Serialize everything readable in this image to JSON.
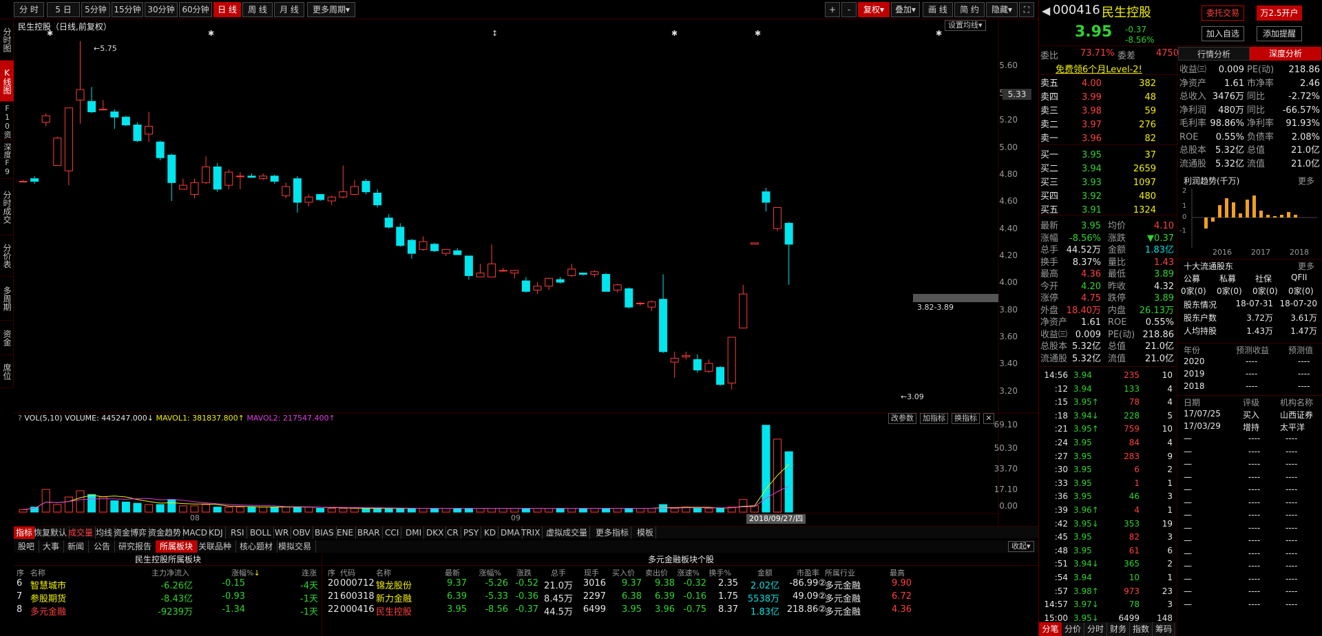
{
  "toolbar": {
    "periods": [
      "分 时",
      "5 日",
      "5分钟",
      "15分钟",
      "30分钟",
      "60分钟",
      "日 线",
      "周 线",
      "月 线",
      "更多周期"
    ],
    "active_period": 6,
    "right_tools": [
      "+",
      "-",
      "复权",
      "叠加",
      "画 线",
      "简 约",
      "隐藏",
      "⛶"
    ]
  },
  "left_tabs": [
    "分时图",
    "K线图",
    "F10资料",
    "深度F9",
    "分时成交",
    "分价表",
    "多周期",
    "资金",
    "席位"
  ],
  "left_active": 1,
  "chart": {
    "title": "民生控股（日线,前复权）",
    "ma_setting": "设置均线",
    "price_labels": [
      "5.60",
      "5.40",
      "5.20",
      "5.00",
      "4.80",
      "4.60",
      "4.40",
      "4.20",
      "4.00",
      "3.80",
      "3.60",
      "3.40",
      "3.20"
    ],
    "current_price_tag": "5.33",
    "high_label": "5.75",
    "low_label": "3.09",
    "range_label": "3.82-3.89",
    "vol_header": {
      "name": "VOL(5,10)",
      "volume": "VOLUME: 445247.000",
      "mavol1": "MAVOL1: 381837.800",
      "mavol2": "MAVOL2: 217547.400"
    },
    "vol_buttons": [
      "改参数",
      "加指标",
      "换指标",
      "✕"
    ],
    "vol_labels": [
      "69.10",
      "50.30",
      "33.70",
      "17.10",
      "0.00"
    ],
    "x_labels": [
      "08",
      "09"
    ],
    "date_label": "2018/09/27/四"
  },
  "chart_data": {
    "type": "candlestick",
    "candles": [
      [
        4.68,
        4.68,
        4.69,
        4.68
      ],
      [
        4.7,
        4.68,
        4.72,
        4.66
      ],
      [
        5.13,
        5.18,
        5.2,
        5.1
      ],
      [
        4.8,
        5.01,
        5.02,
        4.8
      ],
      [
        4.76,
        5.24,
        5.24,
        4.65
      ],
      [
        5.3,
        5.38,
        5.75,
        5.12
      ],
      [
        5.29,
        5.21,
        5.4,
        5.2
      ],
      [
        5.23,
        5.23,
        5.3,
        5.22
      ],
      [
        5.21,
        5.17,
        5.23,
        5.08
      ],
      [
        5.17,
        5.11,
        5.18,
        5.1
      ],
      [
        5.11,
        4.99,
        5.13,
        4.98
      ],
      [
        5.04,
        5.1,
        5.21,
        4.98
      ],
      [
        4.98,
        4.86,
        4.99,
        4.84
      ],
      [
        4.88,
        4.67,
        4.89,
        4.53
      ],
      [
        4.62,
        4.65,
        4.7,
        4.62
      ],
      [
        4.58,
        4.67,
        4.7,
        4.55
      ],
      [
        4.67,
        4.79,
        4.87,
        4.66
      ],
      [
        4.79,
        4.62,
        4.82,
        4.6
      ],
      [
        4.65,
        4.75,
        4.77,
        4.62
      ],
      [
        4.72,
        4.72,
        4.75,
        4.62
      ],
      [
        4.72,
        4.71,
        4.74,
        4.71
      ],
      [
        4.7,
        4.72,
        4.74,
        4.69
      ],
      [
        4.72,
        4.68,
        4.73,
        4.66
      ],
      [
        4.57,
        4.64,
        4.67,
        4.55
      ],
      [
        4.7,
        4.52,
        4.72,
        4.44
      ],
      [
        4.52,
        4.56,
        4.58,
        4.49
      ],
      [
        4.58,
        4.54,
        4.58,
        4.53
      ],
      [
        4.53,
        4.56,
        4.57,
        4.5
      ],
      [
        4.56,
        4.6,
        4.8,
        4.55
      ],
      [
        4.58,
        4.64,
        4.69,
        4.58
      ],
      [
        4.68,
        4.6,
        4.7,
        4.58
      ],
      [
        4.59,
        4.5,
        4.62,
        4.48
      ],
      [
        4.4,
        4.33,
        4.43,
        4.32
      ],
      [
        4.33,
        4.19,
        4.36,
        4.18
      ],
      [
        4.23,
        4.13,
        4.24,
        4.09
      ],
      [
        4.16,
        4.22,
        4.26,
        4.15
      ],
      [
        4.2,
        4.15,
        4.21,
        4.14
      ],
      [
        4.13,
        4.16,
        4.16,
        4.11
      ],
      [
        4.15,
        4.12,
        4.17,
        4.12
      ],
      [
        4.11,
        3.96,
        4.11,
        3.93
      ],
      [
        3.95,
        3.98,
        4.05,
        3.95
      ],
      [
        3.95,
        4.05,
        4.2,
        3.95
      ],
      [
        4.0,
        4.0,
        4.02,
        3.99
      ],
      [
        3.98,
        4.0,
        4.0,
        3.94
      ],
      [
        3.92,
        3.84,
        3.95,
        3.83
      ],
      [
        3.85,
        3.88,
        3.91,
        3.82
      ],
      [
        3.88,
        3.94,
        3.94,
        3.85
      ],
      [
        3.93,
        3.91,
        3.95,
        3.9
      ],
      [
        3.96,
        4.01,
        4.05,
        3.95
      ],
      [
        3.98,
        3.97,
        3.98,
        3.96
      ],
      [
        3.97,
        3.99,
        4.0,
        3.95
      ],
      [
        3.97,
        3.84,
        3.98,
        3.84
      ],
      [
        3.85,
        3.89,
        3.9,
        3.83
      ],
      [
        3.86,
        3.72,
        3.87,
        3.71
      ],
      [
        3.75,
        3.75,
        3.76,
        3.73
      ],
      [
        3.72,
        3.76,
        3.77,
        3.69
      ],
      [
        3.78,
        3.38,
        3.97,
        3.37
      ],
      [
        3.3,
        3.33,
        3.38,
        3.18
      ],
      [
        3.34,
        3.35,
        3.38,
        3.32
      ],
      [
        3.32,
        3.24,
        3.36,
        3.22
      ],
      [
        3.23,
        3.29,
        3.32,
        3.22
      ],
      [
        3.26,
        3.13,
        3.27,
        3.12
      ],
      [
        3.14,
        3.49,
        3.49,
        3.09
      ],
      [
        3.56,
        3.82,
        3.89,
        3.56
      ],
      [
        4.2,
        4.21,
        4.21,
        4.2
      ],
      [
        4.6,
        4.52,
        4.63,
        4.45
      ],
      [
        4.32,
        4.48,
        4.48,
        4.3
      ],
      [
        4.36,
        4.2,
        4.37,
        3.89
      ]
    ],
    "volume": [
      2,
      4,
      18,
      6,
      12,
      17,
      14,
      12,
      9,
      8,
      7,
      6,
      6,
      10,
      5,
      5,
      6,
      4,
      4,
      4,
      4,
      4,
      4,
      4,
      4,
      4,
      3,
      3,
      3,
      3,
      3,
      3,
      3,
      3,
      3,
      3,
      3,
      3,
      3,
      3,
      3,
      3,
      3,
      3,
      3,
      3,
      3,
      3,
      3,
      3,
      3,
      3,
      3,
      3,
      3,
      3,
      6,
      3,
      4,
      3,
      3,
      3,
      4,
      10,
      5,
      69,
      58,
      48
    ],
    "ylim": [
      3.08,
      5.78
    ]
  },
  "stock": {
    "code": "000416",
    "name": "民生控股",
    "price": "3.95",
    "change": "-0.37",
    "pct": "-8.56%",
    "buttons": {
      "order": "委托交易",
      "open": "万2.5开户",
      "watch": "加入自选",
      "alert": "添加提醒"
    }
  },
  "weibi": {
    "label1": "委比",
    "v1": "73.71%",
    "label2": "委差",
    "v2": "4750",
    "promo": "免费领6个月Level-2!"
  },
  "orderbook": [
    {
      "l": "卖五",
      "p": "4.00",
      "v": "382",
      "pc": "r"
    },
    {
      "l": "卖四",
      "p": "3.99",
      "v": "48",
      "pc": "r"
    },
    {
      "l": "卖三",
      "p": "3.98",
      "v": "59",
      "pc": "r"
    },
    {
      "l": "卖二",
      "p": "3.97",
      "v": "276",
      "pc": "r"
    },
    {
      "l": "卖一",
      "p": "3.96",
      "v": "82",
      "pc": "r"
    },
    {
      "l": "买一",
      "p": "3.95",
      "v": "37",
      "pc": "g"
    },
    {
      "l": "买二",
      "p": "3.94",
      "v": "2659",
      "pc": "g"
    },
    {
      "l": "买三",
      "p": "3.93",
      "v": "1097",
      "pc": "g"
    },
    {
      "l": "买四",
      "p": "3.92",
      "v": "480",
      "pc": "g"
    },
    {
      "l": "买五",
      "p": "3.91",
      "v": "1324",
      "pc": "g"
    }
  ],
  "stats": [
    [
      {
        "k": "最新",
        "v": "3.95",
        "c": "g"
      },
      {
        "k": "均价",
        "v": "4.10",
        "c": "r"
      }
    ],
    [
      {
        "k": "涨幅",
        "v": "-8.56%",
        "c": "g"
      },
      {
        "k": "涨跌",
        "v": "▼0.37",
        "c": "g"
      }
    ],
    [
      {
        "k": "总手",
        "v": "44.52万",
        "c": "w"
      },
      {
        "k": "金额",
        "v": "1.83亿",
        "c": "c"
      }
    ],
    [
      {
        "k": "换手",
        "v": "8.37%",
        "c": "w"
      },
      {
        "k": "量比",
        "v": "1.43",
        "c": "r"
      }
    ],
    [
      {
        "k": "最高",
        "v": "4.36",
        "c": "r"
      },
      {
        "k": "最低",
        "v": "3.89",
        "c": "g"
      }
    ],
    [
      {
        "k": "今开",
        "v": "4.20",
        "c": "g"
      },
      {
        "k": "昨收",
        "v": "4.32",
        "c": "w"
      }
    ],
    [
      {
        "k": "涨停",
        "v": "4.75",
        "c": "r"
      },
      {
        "k": "跌停",
        "v": "3.89",
        "c": "g"
      }
    ],
    [
      {
        "k": "外盘",
        "v": "18.40万",
        "c": "r"
      },
      {
        "k": "内盘",
        "v": "26.13万",
        "c": "g"
      }
    ],
    [
      {
        "k": "净资产",
        "v": "1.61",
        "c": "w"
      },
      {
        "k": "ROE",
        "v": "0.55%",
        "c": "w"
      }
    ],
    [
      {
        "k": "收益㈢",
        "v": "0.009",
        "c": "w"
      },
      {
        "k": "PE(动)",
        "v": "218.86",
        "c": "w"
      }
    ],
    [
      {
        "k": "总股本",
        "v": "5.32亿",
        "c": "w"
      },
      {
        "k": "总值",
        "v": "21.0亿",
        "c": "w"
      }
    ],
    [
      {
        "k": "流通股",
        "v": "5.32亿",
        "c": "w"
      },
      {
        "k": "流值",
        "v": "21.0亿",
        "c": "w"
      }
    ]
  ],
  "ticks": [
    {
      "t": "14:56",
      "p": "3.94",
      "v": "235",
      "n": "10",
      "pc": "g",
      "vc": "r"
    },
    {
      "t": ":12",
      "p": "3.94",
      "v": "133",
      "n": "4",
      "pc": "g",
      "vc": "g"
    },
    {
      "t": ":15",
      "p": "3.95↑",
      "v": "78",
      "n": "4",
      "pc": "g",
      "vc": "r"
    },
    {
      "t": ":18",
      "p": "3.94↓",
      "v": "228",
      "n": "5",
      "pc": "g",
      "vc": "g"
    },
    {
      "t": ":21",
      "p": "3.95↑",
      "v": "759",
      "n": "10",
      "pc": "g",
      "vc": "r"
    },
    {
      "t": ":24",
      "p": "3.95",
      "v": "84",
      "n": "4",
      "pc": "g",
      "vc": "r"
    },
    {
      "t": ":27",
      "p": "3.95",
      "v": "283",
      "n": "9",
      "pc": "g",
      "vc": "r"
    },
    {
      "t": ":30",
      "p": "3.95",
      "v": "6",
      "n": "2",
      "pc": "g",
      "vc": "r"
    },
    {
      "t": ":33",
      "p": "3.95",
      "v": "1",
      "n": "1",
      "pc": "g",
      "vc": "r"
    },
    {
      "t": ":36",
      "p": "3.95",
      "v": "46",
      "n": "3",
      "pc": "g",
      "vc": "g"
    },
    {
      "t": ":39",
      "p": "3.96↑",
      "v": "4",
      "n": "1",
      "pc": "g",
      "vc": "r"
    },
    {
      "t": ":42",
      "p": "3.95↓",
      "v": "353",
      "n": "19",
      "pc": "g",
      "vc": "g"
    },
    {
      "t": ":45",
      "p": "3.95",
      "v": "82",
      "n": "3",
      "pc": "g",
      "vc": "r"
    },
    {
      "t": ":48",
      "p": "3.95",
      "v": "61",
      "n": "6",
      "pc": "g",
      "vc": "r"
    },
    {
      "t": ":51",
      "p": "3.94↓",
      "v": "365",
      "n": "2",
      "pc": "g",
      "vc": "g"
    },
    {
      "t": ":54",
      "p": "3.94",
      "v": "10",
      "n": "1",
      "pc": "g",
      "vc": "g"
    },
    {
      "t": ":57",
      "p": "3.98↑",
      "v": "973",
      "n": "23",
      "pc": "g",
      "vc": "r"
    },
    {
      "t": "14:57",
      "p": "3.97↓",
      "v": "78",
      "n": "3",
      "pc": "g",
      "vc": "g"
    },
    {
      "t": "15:00",
      "p": "3.95↓",
      "v": "6499",
      "n": "148",
      "pc": "g",
      "vc": "w"
    }
  ],
  "rtabs": [
    "分笔",
    "分价",
    "分时",
    "财务",
    "指数",
    "筹码"
  ],
  "deep": {
    "tabs": [
      "行情分析",
      "深度分析"
    ],
    "rows": [
      [
        {
          "k": "收益㈢",
          "v": "0.009"
        },
        {
          "k": "PE(动)",
          "v": "218.86"
        }
      ],
      [
        {
          "k": "净资产",
          "v": "1.61"
        },
        {
          "k": "市净率",
          "v": "2.46"
        }
      ],
      [
        {
          "k": "总收入",
          "v": "3476万"
        },
        {
          "k": "同比",
          "v": "-2.72%"
        }
      ],
      [
        {
          "k": "净利润",
          "v": "480万"
        },
        {
          "k": "同比",
          "v": "-66.57%"
        }
      ],
      [
        {
          "k": "毛利率",
          "v": "98.86%"
        },
        {
          "k": "净利率",
          "v": "91.93%"
        }
      ],
      [
        {
          "k": "ROE",
          "v": "0.55%"
        },
        {
          "k": "负债率",
          "v": "2.08%"
        }
      ],
      [
        {
          "k": "总股本",
          "v": "5.32亿"
        },
        {
          "k": "总值",
          "v": "21.0亿"
        }
      ],
      [
        {
          "k": "流通股",
          "v": "5.32亿"
        },
        {
          "k": "流值",
          "v": "21.0亿"
        }
      ]
    ],
    "profit_title": "利润趋势(千万)",
    "more": "更多",
    "profit_y": [
      "2",
      "1",
      "0",
      "-1"
    ],
    "profit_x": [
      "2016",
      "2017",
      "2018"
    ],
    "holders_title": "十大流通股东",
    "holders_head": [
      "公募",
      "私募",
      "社保",
      "QFII"
    ],
    "holders_vals": [
      "0家(0)",
      "0家(0)",
      "0家(0)",
      "0家(0)"
    ],
    "holders_rows": [
      [
        "股东情况",
        "18-07-31",
        "18-07-20"
      ],
      [
        "股东户数",
        "3.72万",
        "3.61万"
      ],
      [
        "人均持股",
        "1.43万",
        "1.47万"
      ]
    ],
    "forecast_head": [
      "年份",
      "预测收益",
      "预测值"
    ],
    "forecast_rows": [
      [
        "2020",
        "----",
        "----"
      ],
      [
        "2019",
        "----",
        "----"
      ],
      [
        "2018",
        "----",
        "----"
      ]
    ],
    "rating_head": [
      "日期",
      "评级",
      "机构名称"
    ],
    "rating_rows": [
      [
        "17/07/25",
        "买入",
        "山西证券"
      ],
      [
        "17/03/29",
        "增持",
        "太平洋"
      ]
    ]
  },
  "indicator_tabs": [
    "指标",
    "恢复默认",
    "成交量",
    "均线",
    "资金博弈",
    "资金趋势",
    "MACD",
    "KDJ",
    "RSI",
    "BOLL",
    "WR",
    "OBV",
    "BIAS",
    "ENE",
    "BRAR",
    "CCI",
    "DMI",
    "DKX",
    "CR",
    "PSY",
    "KD",
    "DMA",
    "TRIX",
    "虚拟成交量",
    "更多指标",
    "模板"
  ],
  "bottom_tabs": [
    "股吧",
    "大事",
    "新闻",
    "公告",
    "研究报告",
    "所属板块",
    "关联品种",
    "核心题材",
    "模拟交易"
  ],
  "bottom_collapse": "收起",
  "sector_panel": {
    "title": "民生控股所属板块",
    "head": [
      "序",
      "名称",
      "主力净流入",
      "涨幅%",
      "连涨"
    ],
    "rows": [
      {
        "no": "6",
        "name": "智慧城市",
        "flow": "-6.26亿",
        "pct": "-0.15",
        "streak": "-4天",
        "nc": "y"
      },
      {
        "no": "7",
        "name": "参股期货",
        "flow": "-8.43亿",
        "pct": "-0.93",
        "streak": "-1天",
        "nc": "y"
      },
      {
        "no": "8",
        "name": "多元金融",
        "flow": "-9239万",
        "pct": "-1.34",
        "streak": "-1天",
        "nc": "r"
      }
    ]
  },
  "stocks_panel": {
    "title": "多元金融板块个股",
    "head": [
      "序",
      "代码",
      "名称",
      "最新",
      "涨幅%",
      "涨跌",
      "总手",
      "现手",
      "买入价",
      "卖出价",
      "涨速%",
      "换手%",
      "金额",
      "市盈率",
      "所属行业",
      "最高"
    ],
    "rows": [
      [
        "20",
        "000712",
        "锦龙股份",
        "9.37",
        "-5.26",
        "-0.52",
        "21.0万",
        "3016",
        "9.37",
        "9.38",
        "-0.32",
        "2.35",
        "2.02亿",
        "-86.99②",
        "多元金融",
        "9.90"
      ],
      [
        "21",
        "600318",
        "新力金融",
        "6.39",
        "-5.33",
        "-0.36",
        "8.45万",
        "2297",
        "6.38",
        "6.39",
        "-0.16",
        "1.75",
        "5538万",
        "49.09②",
        "多元金融",
        "6.72"
      ],
      [
        "22",
        "000416",
        "民生控股",
        "3.95",
        "-8.56",
        "-0.37",
        "44.5万",
        "6499",
        "3.95",
        "3.96",
        "-0.75",
        "8.37",
        "1.83亿",
        "218.86②",
        "多元金融",
        "4.36"
      ]
    ]
  }
}
